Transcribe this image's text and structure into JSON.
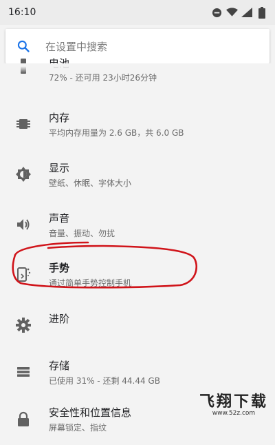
{
  "status_bar": {
    "time": "16:10"
  },
  "search": {
    "placeholder": "在设置中搜索"
  },
  "settings": [
    {
      "title": "电池",
      "subtitle": "72% - 还可用 23小时26分钟",
      "icon": "battery-icon"
    },
    {
      "title": "内存",
      "subtitle": "平均内存用量为 2.6 GB，共 6.0 GB",
      "icon": "memory-icon"
    },
    {
      "title": "显示",
      "subtitle": "壁纸、休眠、字体大小",
      "icon": "display-brightness-icon"
    },
    {
      "title": "声音",
      "subtitle": "音量、振动、勿扰",
      "icon": "volume-icon"
    },
    {
      "title": "手势",
      "subtitle": "通过简单手势控制手机",
      "icon": "gesture-phone-icon"
    },
    {
      "title": "进阶",
      "subtitle": "",
      "icon": "gear-icon"
    },
    {
      "title": "存储",
      "subtitle": "已使用 31% - 还剩 44.44 GB",
      "icon": "storage-icon"
    },
    {
      "title": "安全性和位置信息",
      "subtitle": "屏幕锁定、指纹",
      "icon": "lock-icon"
    }
  ],
  "watermark": {
    "brand": "飞翔下载",
    "url": "www.52z.com"
  },
  "colors": {
    "background": "#f3f3f3",
    "accent": "#1a73e8",
    "highlight_circle": "#d0141a"
  }
}
